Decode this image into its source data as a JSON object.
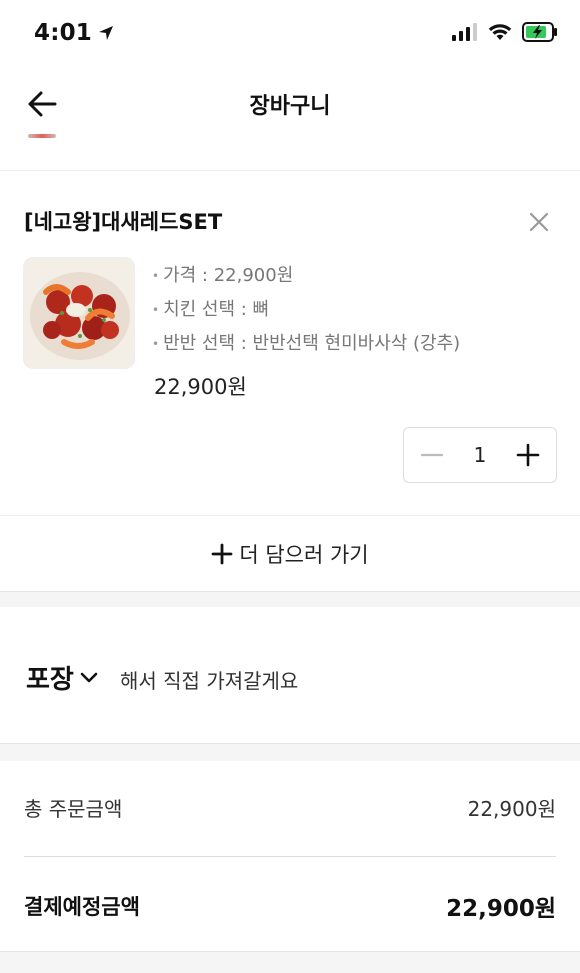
{
  "status": {
    "time": "4:01"
  },
  "header": {
    "title": "장바구니"
  },
  "cart_item": {
    "name": "[네고왕]대새레드SET",
    "options": [
      "가격 : 22,900원",
      "치킨 선택 : 뼈",
      "반반 선택 : 반반선택 현미바사삭 (강추)"
    ],
    "price": "22,900원",
    "quantity": "1"
  },
  "add_more": {
    "label": "더 담으러 가기"
  },
  "pickup": {
    "method": "포장",
    "description": "해서 직접 가져갈게요"
  },
  "summary": {
    "total_label": "총 주문금액",
    "total_value": "22,900원",
    "payment_label": "결제예정금액",
    "payment_value": "22,900원"
  },
  "colors": {
    "battery": "#34c759",
    "divider": "#eeeeee",
    "band": "#f5f5f5"
  }
}
